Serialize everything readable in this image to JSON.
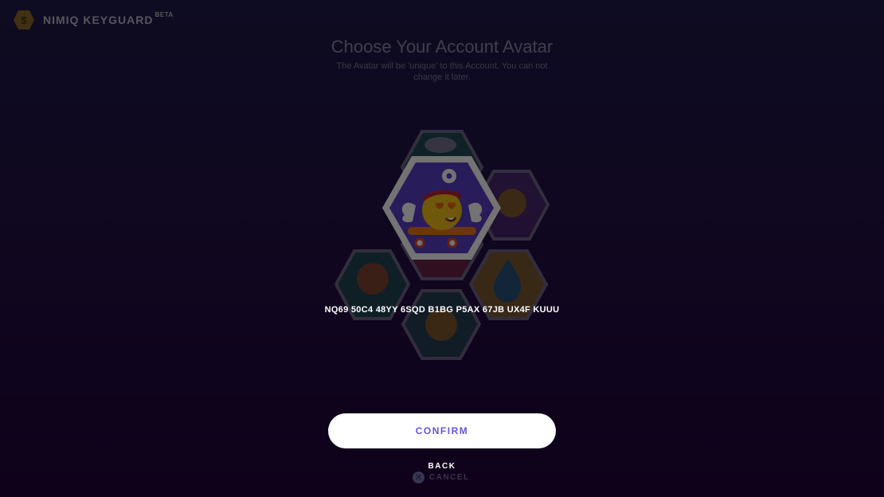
{
  "app": {
    "logo_text": "NIMIQ KEYGUARD",
    "beta_label": "BETA",
    "logo_icon": "nimiq-hexagon-logo"
  },
  "header": {
    "title": "Choose Your Account Avatar",
    "subtitle": "The Avatar will be 'unique' to this Account. You can not change it later."
  },
  "avatars": {
    "selected": {
      "icon": "emoji-avatar-wings-skateboard",
      "background": "#5b3fc8"
    },
    "others": [
      {
        "icon": "avatar-chef-hat",
        "background": "#1f8b6c"
      },
      {
        "icon": "avatar-headlamp",
        "background": "#7b3fa0"
      },
      {
        "icon": "avatar-heart-eyes",
        "background": "#c0394f"
      },
      {
        "icon": "avatar-orange-megaphone",
        "background": "#1e8a6a"
      },
      {
        "icon": "avatar-water-drop",
        "background": "#e8b920"
      },
      {
        "icon": "avatar-top-hat-bowtie",
        "background": "#2b7f6a"
      }
    ]
  },
  "account": {
    "address": "NQ69 50C4 48YY 6SQD B1BG P5AX 67JB UX4F KUUU"
  },
  "actions": {
    "confirm_label": "CONFIRM",
    "back_label": "BACK",
    "cancel_label": "CANCEL",
    "cancel_icon": "close-circle-icon"
  },
  "colors": {
    "accent": "#6655e0",
    "background_top": "#1f1b4c",
    "background_bottom": "#22033b"
  }
}
